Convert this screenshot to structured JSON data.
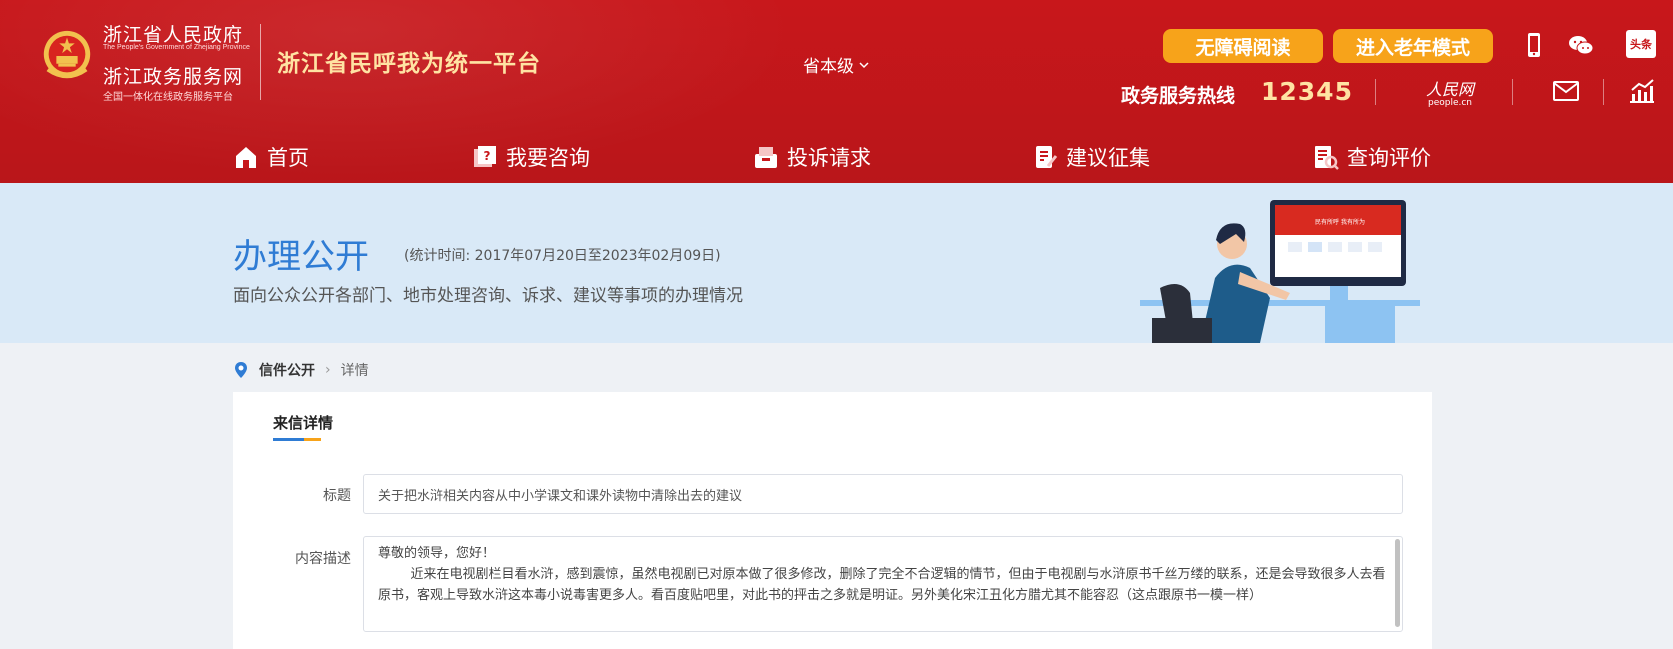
{
  "header": {
    "gov_name": "浙江省人民政府",
    "gov_name_en": "The People's Government of Zhejiang Province",
    "service_name": "浙江政务服务网",
    "service_sub": "全国一体化在线政务服务平台",
    "platform_title": "浙江省民呼我为统一平台",
    "level_select": "省本级",
    "accessibility_button": "无障碍阅读",
    "elder_mode_button": "进入老年模式",
    "toutiao_label": "头条",
    "hotline_label": "政务服务热线",
    "hotline_number": "12345",
    "people_cn": "人民网",
    "people_en": "people.cn"
  },
  "nav": {
    "items": [
      {
        "label": "首页",
        "icon": "home-icon"
      },
      {
        "label": "我要咨询",
        "icon": "consult-icon"
      },
      {
        "label": "投诉请求",
        "icon": "complaint-icon"
      },
      {
        "label": "建议征集",
        "icon": "suggestion-icon"
      },
      {
        "label": "查询评价",
        "icon": "query-icon"
      }
    ]
  },
  "banner": {
    "title": "办理公开",
    "period": "(统计时间: 2017年07月20日至2023年02月09日)",
    "description": "面向公众公开各部门、地市处理咨询、诉求、建议等事项的办理情况",
    "screen_text": "民有所呼 我有所为"
  },
  "breadcrumb": {
    "home": "信件公开",
    "current": "详情"
  },
  "detail": {
    "tab_label": "来信详情",
    "title_label": "标题",
    "title_value": "关于把水浒相关内容从中小学课文和课外读物中清除出去的建议",
    "content_label": "内容描述",
    "content_greeting": "尊敬的领导，您好！",
    "content_body": "近来在电视剧栏目看水浒，感到震惊，虽然电视剧已对原本做了很多修改，删除了完全不合逻辑的情节，但由于电视剧与水浒原书千丝万缕的联系，还是会导致很多人去看原书，客观上导致水浒这本毒小说毒害更多人。看百度贴吧里，对此书的抨击之多就是明证。另外美化宋江丑化方腊尤其不能容忍（这点跟原书一模一样）"
  },
  "colors": {
    "header_red": "#c8171b",
    "accent_orange": "#f7a31a",
    "title_gold": "#ffe3a3",
    "banner_blue": "#2f7cd4",
    "banner_bg": "#d9e9f7"
  }
}
